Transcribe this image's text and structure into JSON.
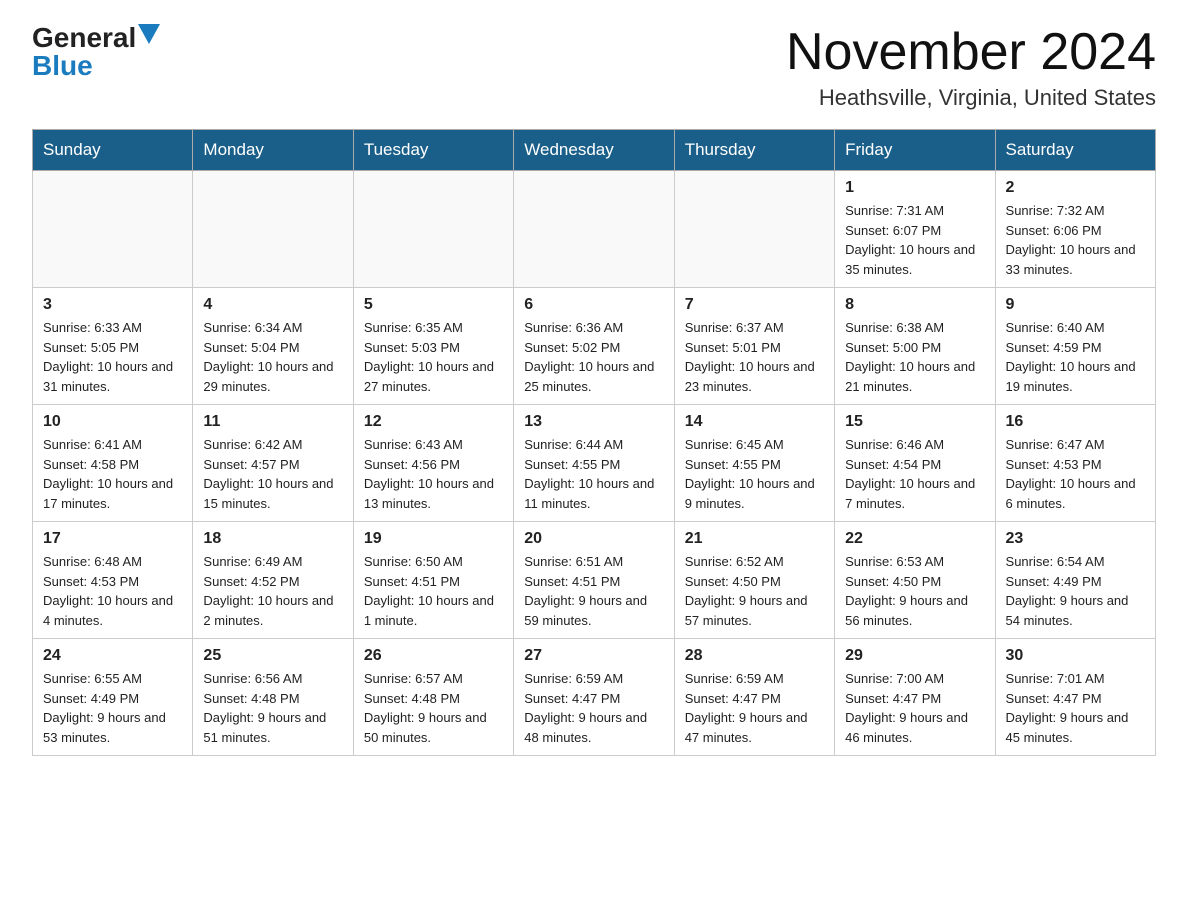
{
  "header": {
    "logo_general": "General",
    "logo_blue": "Blue",
    "main_title": "November 2024",
    "subtitle": "Heathsville, Virginia, United States"
  },
  "days_of_week": [
    "Sunday",
    "Monday",
    "Tuesday",
    "Wednesday",
    "Thursday",
    "Friday",
    "Saturday"
  ],
  "weeks": [
    [
      {
        "day": "",
        "info": ""
      },
      {
        "day": "",
        "info": ""
      },
      {
        "day": "",
        "info": ""
      },
      {
        "day": "",
        "info": ""
      },
      {
        "day": "",
        "info": ""
      },
      {
        "day": "1",
        "info": "Sunrise: 7:31 AM\nSunset: 6:07 PM\nDaylight: 10 hours and 35 minutes."
      },
      {
        "day": "2",
        "info": "Sunrise: 7:32 AM\nSunset: 6:06 PM\nDaylight: 10 hours and 33 minutes."
      }
    ],
    [
      {
        "day": "3",
        "info": "Sunrise: 6:33 AM\nSunset: 5:05 PM\nDaylight: 10 hours and 31 minutes."
      },
      {
        "day": "4",
        "info": "Sunrise: 6:34 AM\nSunset: 5:04 PM\nDaylight: 10 hours and 29 minutes."
      },
      {
        "day": "5",
        "info": "Sunrise: 6:35 AM\nSunset: 5:03 PM\nDaylight: 10 hours and 27 minutes."
      },
      {
        "day": "6",
        "info": "Sunrise: 6:36 AM\nSunset: 5:02 PM\nDaylight: 10 hours and 25 minutes."
      },
      {
        "day": "7",
        "info": "Sunrise: 6:37 AM\nSunset: 5:01 PM\nDaylight: 10 hours and 23 minutes."
      },
      {
        "day": "8",
        "info": "Sunrise: 6:38 AM\nSunset: 5:00 PM\nDaylight: 10 hours and 21 minutes."
      },
      {
        "day": "9",
        "info": "Sunrise: 6:40 AM\nSunset: 4:59 PM\nDaylight: 10 hours and 19 minutes."
      }
    ],
    [
      {
        "day": "10",
        "info": "Sunrise: 6:41 AM\nSunset: 4:58 PM\nDaylight: 10 hours and 17 minutes."
      },
      {
        "day": "11",
        "info": "Sunrise: 6:42 AM\nSunset: 4:57 PM\nDaylight: 10 hours and 15 minutes."
      },
      {
        "day": "12",
        "info": "Sunrise: 6:43 AM\nSunset: 4:56 PM\nDaylight: 10 hours and 13 minutes."
      },
      {
        "day": "13",
        "info": "Sunrise: 6:44 AM\nSunset: 4:55 PM\nDaylight: 10 hours and 11 minutes."
      },
      {
        "day": "14",
        "info": "Sunrise: 6:45 AM\nSunset: 4:55 PM\nDaylight: 10 hours and 9 minutes."
      },
      {
        "day": "15",
        "info": "Sunrise: 6:46 AM\nSunset: 4:54 PM\nDaylight: 10 hours and 7 minutes."
      },
      {
        "day": "16",
        "info": "Sunrise: 6:47 AM\nSunset: 4:53 PM\nDaylight: 10 hours and 6 minutes."
      }
    ],
    [
      {
        "day": "17",
        "info": "Sunrise: 6:48 AM\nSunset: 4:53 PM\nDaylight: 10 hours and 4 minutes."
      },
      {
        "day": "18",
        "info": "Sunrise: 6:49 AM\nSunset: 4:52 PM\nDaylight: 10 hours and 2 minutes."
      },
      {
        "day": "19",
        "info": "Sunrise: 6:50 AM\nSunset: 4:51 PM\nDaylight: 10 hours and 1 minute."
      },
      {
        "day": "20",
        "info": "Sunrise: 6:51 AM\nSunset: 4:51 PM\nDaylight: 9 hours and 59 minutes."
      },
      {
        "day": "21",
        "info": "Sunrise: 6:52 AM\nSunset: 4:50 PM\nDaylight: 9 hours and 57 minutes."
      },
      {
        "day": "22",
        "info": "Sunrise: 6:53 AM\nSunset: 4:50 PM\nDaylight: 9 hours and 56 minutes."
      },
      {
        "day": "23",
        "info": "Sunrise: 6:54 AM\nSunset: 4:49 PM\nDaylight: 9 hours and 54 minutes."
      }
    ],
    [
      {
        "day": "24",
        "info": "Sunrise: 6:55 AM\nSunset: 4:49 PM\nDaylight: 9 hours and 53 minutes."
      },
      {
        "day": "25",
        "info": "Sunrise: 6:56 AM\nSunset: 4:48 PM\nDaylight: 9 hours and 51 minutes."
      },
      {
        "day": "26",
        "info": "Sunrise: 6:57 AM\nSunset: 4:48 PM\nDaylight: 9 hours and 50 minutes."
      },
      {
        "day": "27",
        "info": "Sunrise: 6:59 AM\nSunset: 4:47 PM\nDaylight: 9 hours and 48 minutes."
      },
      {
        "day": "28",
        "info": "Sunrise: 6:59 AM\nSunset: 4:47 PM\nDaylight: 9 hours and 47 minutes."
      },
      {
        "day": "29",
        "info": "Sunrise: 7:00 AM\nSunset: 4:47 PM\nDaylight: 9 hours and 46 minutes."
      },
      {
        "day": "30",
        "info": "Sunrise: 7:01 AM\nSunset: 4:47 PM\nDaylight: 9 hours and 45 minutes."
      }
    ]
  ]
}
